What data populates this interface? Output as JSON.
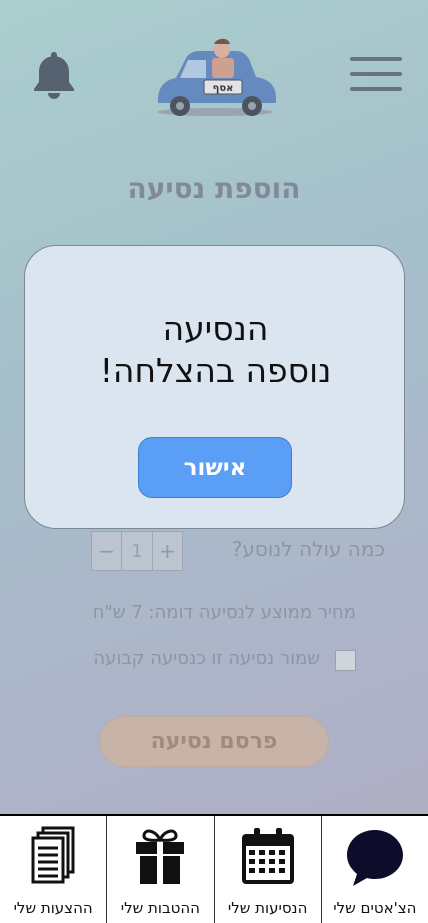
{
  "header": {
    "logo_plate": "אסף",
    "notifications_icon": "bell-icon",
    "menu_icon": "hamburger-icon"
  },
  "page": {
    "title": "הוספת נסיעה",
    "price_question": "כמה עולה לנוסע?",
    "stepper": {
      "minus": "−",
      "value": "1",
      "plus": "+"
    },
    "avg_price": "מחיר ממוצע לנסיעה דומה: 7 ש\"ח",
    "save_fixed": "שמור נסיעה זו כנסיעה קבועה",
    "publish_button": "פרסם נסיעה"
  },
  "modal": {
    "line1": "הנסיעה",
    "line2": "נוספה בהצלחה!",
    "confirm": "אישור"
  },
  "nav": [
    {
      "label": "הצ'אטים שלי",
      "icon": "chat-bubble-icon"
    },
    {
      "label": "הנסיעות שלי",
      "icon": "calendar-icon"
    },
    {
      "label": "ההטבות שלי",
      "icon": "gift-icon"
    },
    {
      "label": "ההצעות שלי",
      "icon": "documents-icon"
    }
  ],
  "colors": {
    "accent": "#5a9ef5",
    "publish": "#d3b7a6"
  }
}
